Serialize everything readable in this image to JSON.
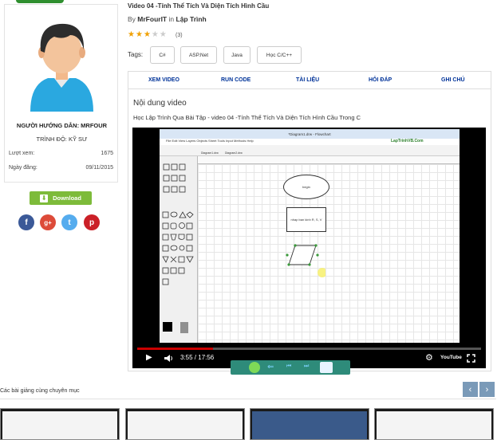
{
  "card": {
    "instructor_label": "NGƯỜI HƯỚNG DẪN: MRFOUR",
    "level_label": "TRÌNH ĐỘ: KỸ SƯ",
    "views_label": "Lượt xem:",
    "views_value": "1675",
    "date_label": "Ngày đăng:",
    "date_value": "09/11/2015",
    "download_label": "Download"
  },
  "social": [
    {
      "name": "facebook",
      "glyph": "f",
      "color": "#3b5998"
    },
    {
      "name": "google-plus",
      "glyph": "g+",
      "color": "#dd4b39"
    },
    {
      "name": "twitter",
      "glyph": "t",
      "color": "#55acee"
    },
    {
      "name": "pinterest",
      "glyph": "p",
      "color": "#cb2027"
    }
  ],
  "video": {
    "title": "Video 04 -Tính Thể Tích Và Diện Tích Hình Cầu",
    "by_label": "By",
    "author": "MrFourIT",
    "in_label": "in",
    "category": "Lập Trình",
    "rating": 3,
    "rating_max": 5,
    "rating_count": "(3)",
    "tags_label": "Tags:",
    "tags": [
      "C#",
      "ASP.Net",
      "Java",
      "Học C/C++"
    ]
  },
  "tabs": [
    "XEM VIDEO",
    "RUN CODE",
    "TÀI LIỆU",
    "HỎI ĐÁP",
    "GHI CHÚ"
  ],
  "content": {
    "section_title": "Nội dung video",
    "subtitle": "Học Lập Trình Qua Bài Tập - video 04 -Tính Thể Tích Và Diện Tích Hình Cầu Trong C"
  },
  "player": {
    "time": "3:55 / 17:56",
    "progress": 0.22,
    "youtube_label": "YouTube",
    "logo_text": "LapTrinhVB.Com",
    "window_title": "*Diagram1.drw - Flowchart",
    "menu": "File  Edit  View  Layers  Objects  Sheet  Tools  Input Methods  Help",
    "oval_text": "begin",
    "rect_text": "nhap ban kinh R, S, V",
    "tab_1": "Diagram1.drw",
    "tab_2": "Diagram2.drw"
  },
  "related": {
    "title": "Các bài giảng cùng chuyên mục"
  },
  "colors": {
    "link_blue": "#003399",
    "download_green": "#7dbb3a",
    "star": "#f0a000",
    "progress_red": "#cc0000"
  }
}
